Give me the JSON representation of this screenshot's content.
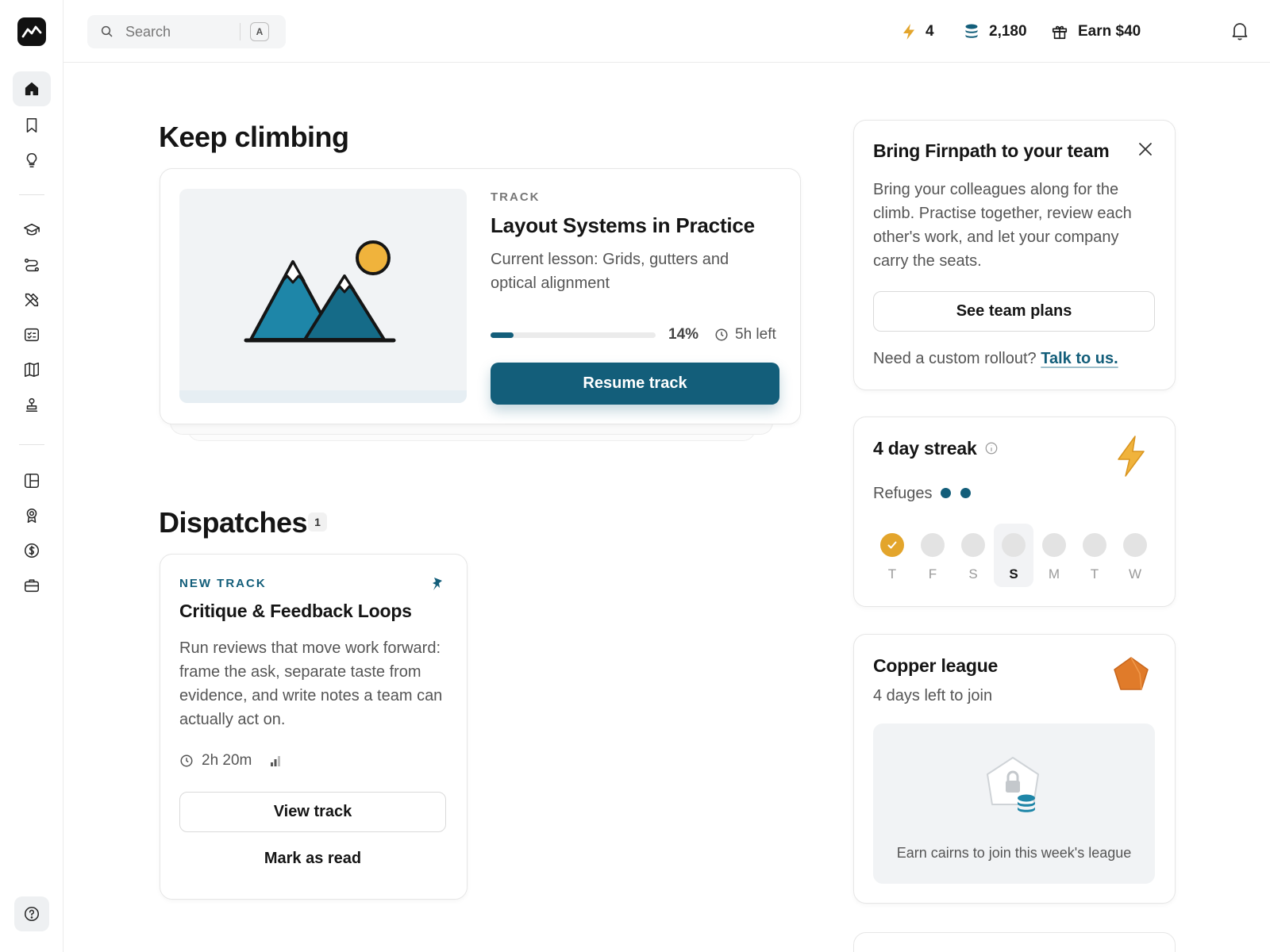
{
  "search": {
    "placeholder": "Search",
    "shortcut": "A"
  },
  "topbar": {
    "streak_count": "4",
    "cairns": "2,180",
    "earn_label": "Earn $40"
  },
  "colors": {
    "accent": "#135e7a",
    "streak": "#e3a52c",
    "league": "#e07b2a"
  },
  "main": {
    "keep_climbing_title": "Keep climbing",
    "track_card": {
      "eyebrow": "TRACK",
      "title": "Layout Systems in Practice",
      "lesson": "Current lesson: Grids, gutters and optical alignment",
      "progress_label": "14%",
      "progress": 0.14,
      "time_left": "5h left",
      "resume_label": "Resume track"
    },
    "dispatches_title": "Dispatches",
    "dispatches_count": "1",
    "dispatch_card": {
      "eyebrow": "NEW TRACK",
      "title": "Critique & Feedback Loops",
      "description": "Run reviews that move work forward: frame the ask, separate taste from evidence, and write notes a team can actually act on.",
      "duration": "2h 20m",
      "view_label": "View track",
      "mark_read_label": "Mark as read"
    }
  },
  "team_card": {
    "title": "Bring Firnpath to your team",
    "body": "Bring your colleagues along for the climb. Practise together, review each other's work, and let your company carry the seats.",
    "button_label": "See team plans",
    "footer_text": "Need a custom rollout?",
    "footer_link": "Talk to us."
  },
  "streak_card": {
    "title": "4 day streak",
    "refuges_label": "Refuges",
    "refuges_count": 2,
    "days": [
      {
        "label": "T",
        "state": "done"
      },
      {
        "label": "F",
        "state": "empty"
      },
      {
        "label": "S",
        "state": "empty"
      },
      {
        "label": "S",
        "state": "today"
      },
      {
        "label": "M",
        "state": "empty"
      },
      {
        "label": "T",
        "state": "empty"
      },
      {
        "label": "W",
        "state": "empty"
      }
    ]
  },
  "league_card": {
    "title": "Copper league",
    "subtitle": "4 days left to join",
    "empty_text": "Earn cairns to join this week's league"
  }
}
